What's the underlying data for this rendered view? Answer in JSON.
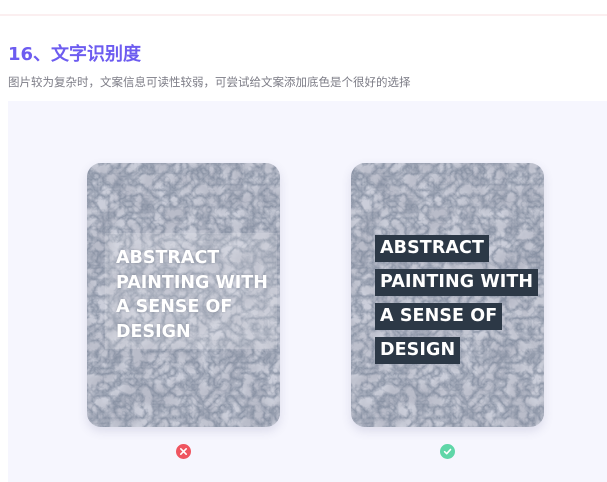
{
  "section": {
    "title": "16、文字识别度",
    "subtitle": "图片较为复杂时，文案信息可读性较弱，可尝试给文案添加底色是个很好的选择"
  },
  "examples": [
    {
      "id": "bad",
      "lines": [
        "ABSTRACT",
        "PAINTING WITH",
        "A SENSE OF",
        "DESIGN"
      ],
      "status_icon": "cross-icon",
      "status_color": "#ef5560"
    },
    {
      "id": "good",
      "lines": [
        "ABSTRACT",
        "PAINTING WITH",
        "A SENSE OF",
        "DESIGN"
      ],
      "status_icon": "check-icon",
      "status_color": "#5fd6a8",
      "highlight_color": "#2c3846"
    }
  ],
  "colors": {
    "title": "#6d5cf0",
    "subtitle": "#7c7c86",
    "panel_bg": "#f6f6fe"
  }
}
